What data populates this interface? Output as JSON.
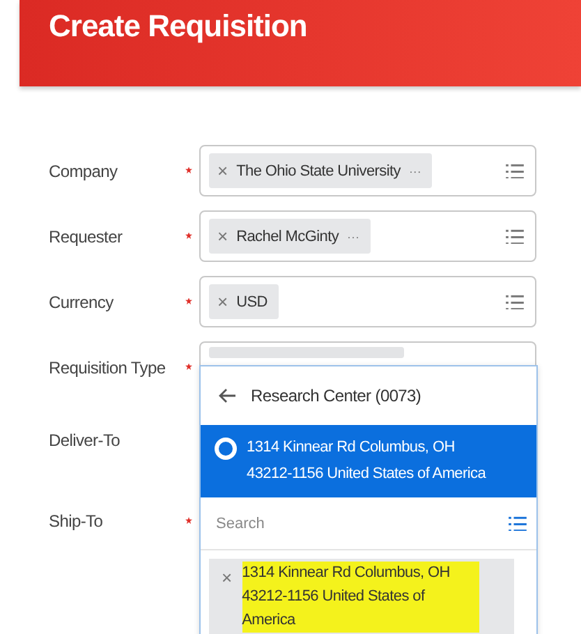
{
  "header": {
    "title": "Create Requisition"
  },
  "fields": [
    {
      "label": "Company",
      "required": true,
      "kind": "select",
      "chips": [
        {
          "remove": "×",
          "text": "The Ohio State University",
          "more": "···"
        }
      ]
    },
    {
      "label": "Requester",
      "required": true,
      "kind": "select",
      "chips": [
        {
          "remove": "×",
          "text": "Rachel McGinty",
          "more": "···"
        }
      ]
    },
    {
      "label": "Currency",
      "required": true,
      "kind": "select",
      "chips": [
        {
          "remove": "×",
          "text": "USD"
        }
      ]
    },
    {
      "label": "Requisition Type",
      "required": true,
      "kind": "blurred"
    },
    {
      "label": "Deliver-To",
      "required": false,
      "kind": "covered"
    },
    {
      "label": "Ship-To",
      "required": true,
      "kind": "covered"
    }
  ],
  "popup": {
    "back_title": "Research Center (0073)",
    "options": [
      {
        "text": "1314 Kinnear Rd Columbus, OH 43212-1156 United States of America",
        "selected": true
      }
    ],
    "search": {
      "placeholder": "Search"
    },
    "selected_chips": [
      {
        "remove": "×",
        "text": "1314 Kinnear Rd Columbus, OH 43212-1156 United States of America",
        "highlighted": true
      }
    ]
  }
}
